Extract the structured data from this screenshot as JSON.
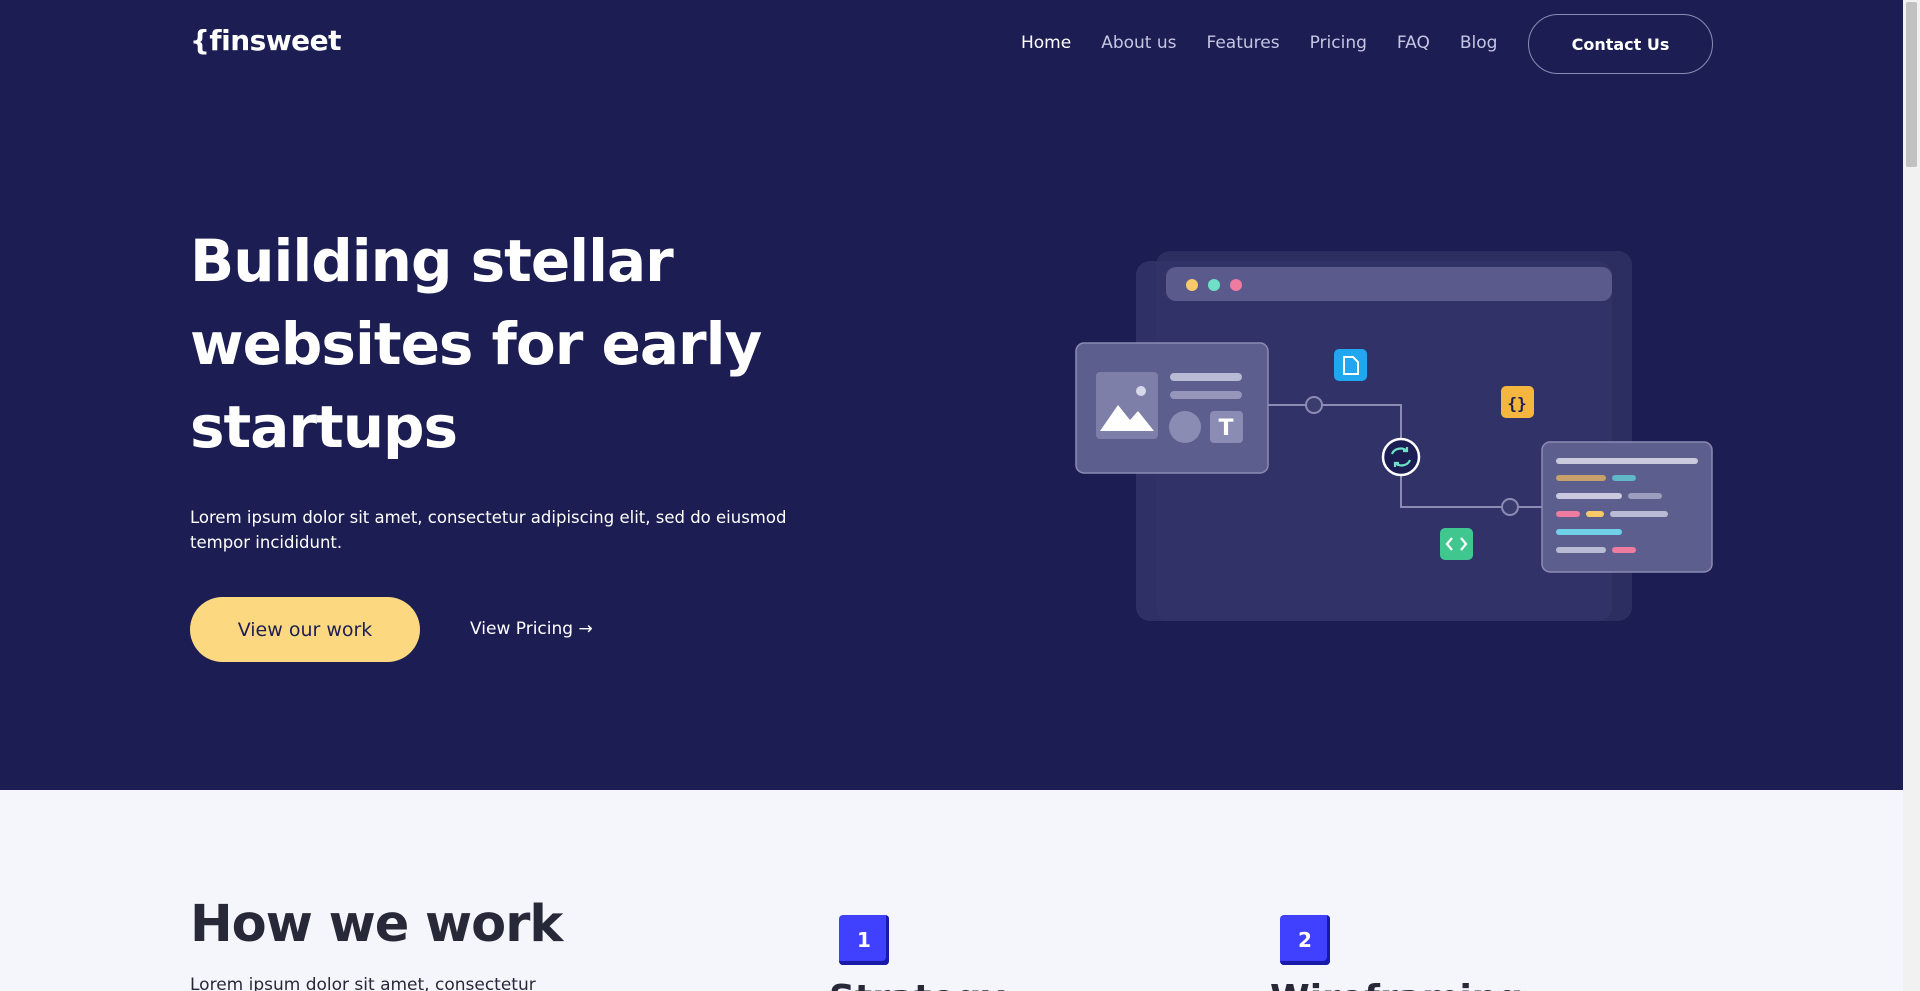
{
  "brand": {
    "logo_text": "{finsweet"
  },
  "nav": {
    "items": [
      {
        "label": "Home",
        "active": true
      },
      {
        "label": "About us",
        "active": false
      },
      {
        "label": "Features",
        "active": false
      },
      {
        "label": "Pricing",
        "active": false
      },
      {
        "label": "FAQ",
        "active": false
      },
      {
        "label": "Blog",
        "active": false
      }
    ],
    "contact_label": "Contact Us"
  },
  "hero": {
    "title": "Building stellar websites for early startups",
    "subtitle": "Lorem ipsum dolor sit amet, consectetur adipiscing elit, sed do eiusmod tempor incididunt.",
    "primary_button": "View our work",
    "secondary_link": "View Pricing →"
  },
  "how_we_work": {
    "title": "How we work",
    "text": "Lorem ipsum dolor sit amet, consectetur",
    "steps": [
      {
        "number": "1",
        "title": "Strategy"
      },
      {
        "number": "2",
        "title": "Wireframing"
      }
    ]
  },
  "colors": {
    "hero_bg": "#1c1e53",
    "accent_yellow": "#fcd980",
    "step_blue": "#4040ff",
    "section_bg": "#f4f6fc",
    "dark_text": "#282938"
  },
  "icons": [
    "image-icon",
    "text-icon",
    "file-icon",
    "braces-icon",
    "sync-icon",
    "code-icon"
  ]
}
